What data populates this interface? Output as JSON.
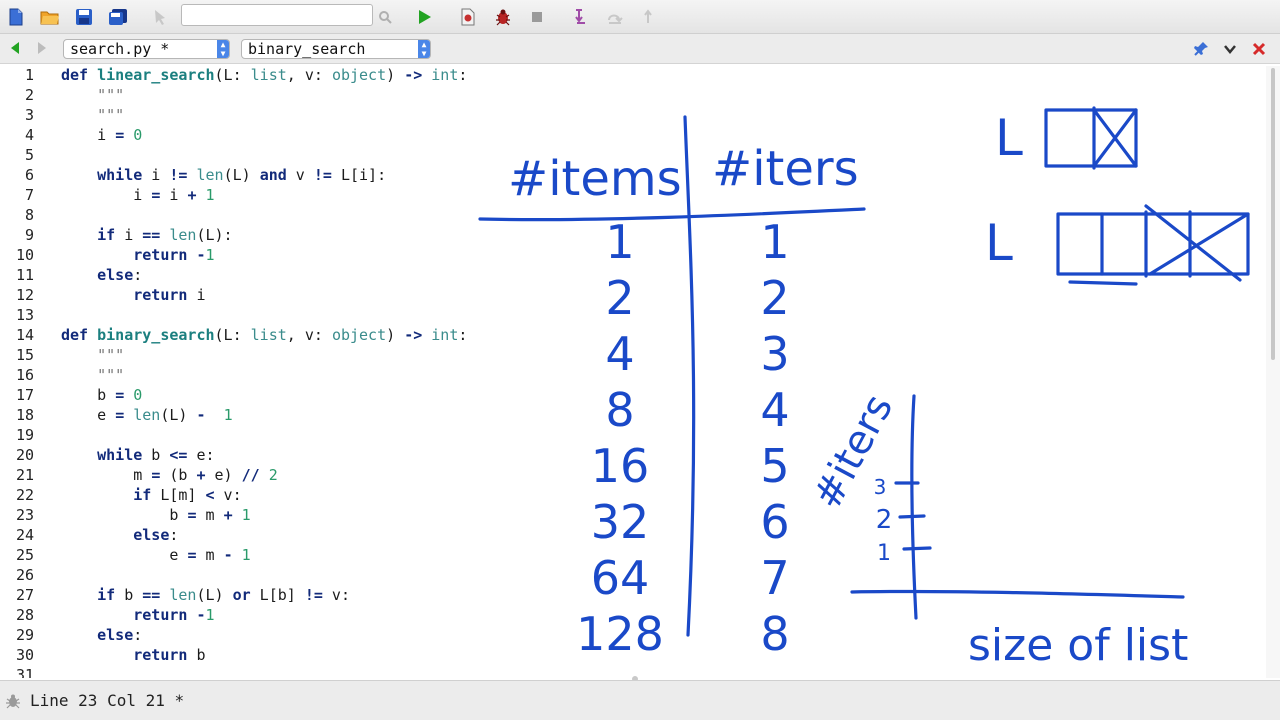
{
  "toolbar": {
    "search_value": "",
    "search_placeholder": "",
    "icons": [
      "new-file-icon",
      "open-folder-icon",
      "save-icon",
      "save-all-icon",
      "pointer-icon",
      "search-icon",
      "run-icon",
      "debug-file-icon",
      "bug-icon",
      "stop-icon",
      "step-into-icon",
      "step-over-icon",
      "step-out-icon"
    ]
  },
  "nav": {
    "file_select": "search.py *",
    "function_select": "binary_search"
  },
  "editor": {
    "line_numbers": [
      "1",
      "2",
      "3",
      "4",
      "5",
      "6",
      "7",
      "8",
      "9",
      "10",
      "11",
      "12",
      "13",
      "14",
      "15",
      "16",
      "17",
      "18",
      "19",
      "20",
      "21",
      "22",
      "23",
      "24",
      "25",
      "26",
      "27",
      "28",
      "29",
      "30",
      "31"
    ]
  },
  "status": {
    "text": "Line 23 Col 21 *"
  },
  "handwriting": {
    "table_header_left": "#items",
    "table_header_right": "#iters",
    "items_column": [
      "1",
      "2",
      "4",
      "8",
      "16",
      "32",
      "64",
      "128"
    ],
    "iters_column": [
      "1",
      "2",
      "3",
      "4",
      "5",
      "6",
      "7",
      "8"
    ],
    "graph_y_label": "#iters",
    "graph_y_ticks": [
      "1",
      "2",
      "3"
    ],
    "graph_x_label": "size of list",
    "list_label_1": "L",
    "list_label_2": "L"
  },
  "colors": {
    "ink": "#1a49c8",
    "keyword": "#122a7a",
    "function_name": "#1b7f7f",
    "run_green": "#22a322",
    "close_red": "#d62a2a"
  }
}
